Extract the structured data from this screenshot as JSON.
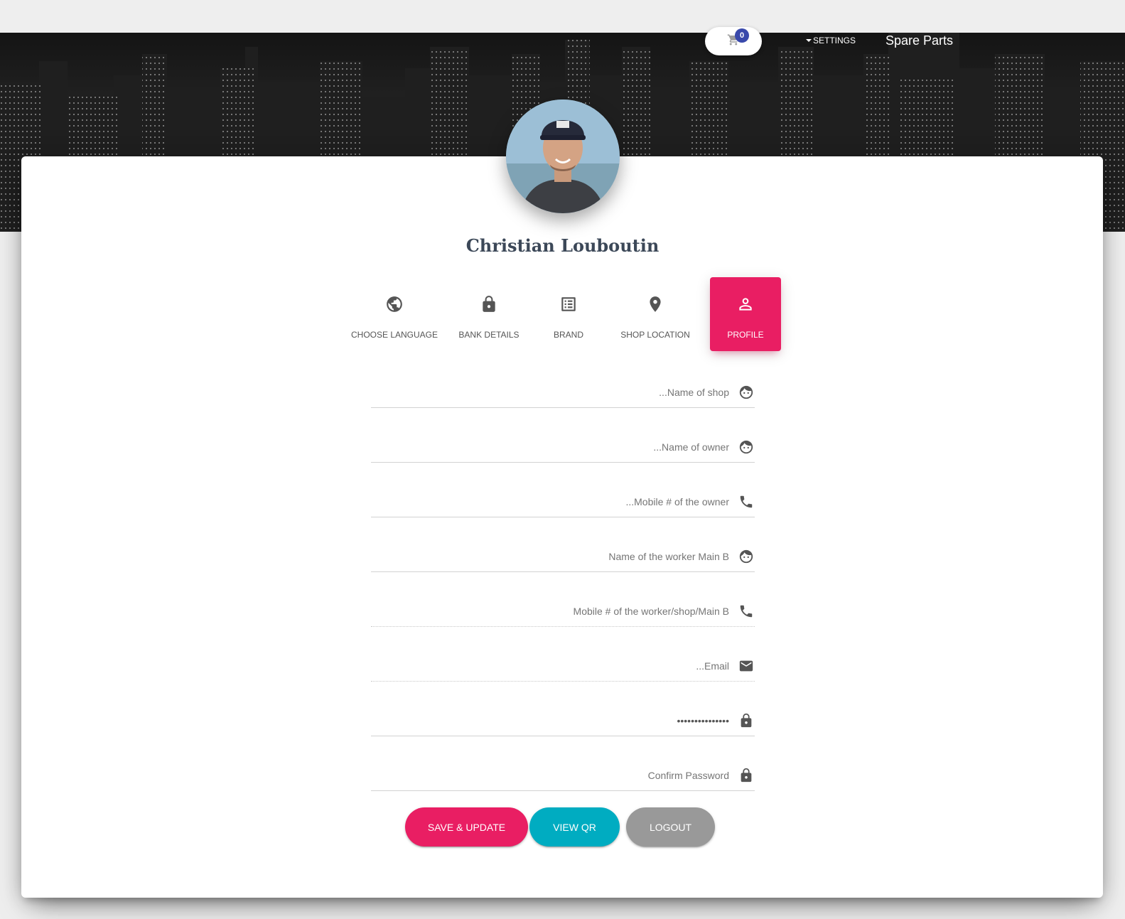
{
  "navbar": {
    "cart_count": "0",
    "settings_label": "SETTINGS",
    "brand": "Spare Parts"
  },
  "profile": {
    "name": "Christian Louboutin"
  },
  "tabs": [
    {
      "label": "CHOOSE LANGUAGE",
      "icon": "globe-icon",
      "active": false
    },
    {
      "label": "BANK DETAILS",
      "icon": "lock-icon",
      "active": false
    },
    {
      "label": "BRAND",
      "icon": "list-icon",
      "active": false
    },
    {
      "label": "SHOP LOCATION",
      "icon": "location-pin-icon",
      "active": false
    },
    {
      "label": "PROFILE",
      "icon": "person-icon",
      "active": true
    }
  ],
  "form": {
    "fields": [
      {
        "placeholder": "...Name of shop",
        "value": "",
        "icon": "face-icon"
      },
      {
        "placeholder": "...Name of owner",
        "value": "",
        "icon": "face-icon"
      },
      {
        "placeholder": "...Mobile # of the owner",
        "value": "",
        "icon": "phone-icon"
      },
      {
        "placeholder": "Name of the worker Main B",
        "value": "",
        "icon": "face-icon"
      },
      {
        "placeholder": "Mobile # of the worker/shop/Main B",
        "value": "",
        "icon": "phone-icon"
      },
      {
        "placeholder": "...Email",
        "value": "",
        "icon": "email-icon"
      },
      {
        "placeholder": "",
        "value": "•••••••••••••••",
        "icon": "lock-icon"
      },
      {
        "placeholder": "Confirm Password",
        "value": "",
        "icon": "lock-icon"
      }
    ]
  },
  "buttons": {
    "save": "SAVE & UPDATE",
    "view_qr": "VIEW QR",
    "logout": "LOGOUT"
  },
  "colors": {
    "primary": "#e91e63",
    "info": "#00acc1",
    "muted": "#999999",
    "badge": "#3949ab",
    "heading": "#3c4858"
  }
}
